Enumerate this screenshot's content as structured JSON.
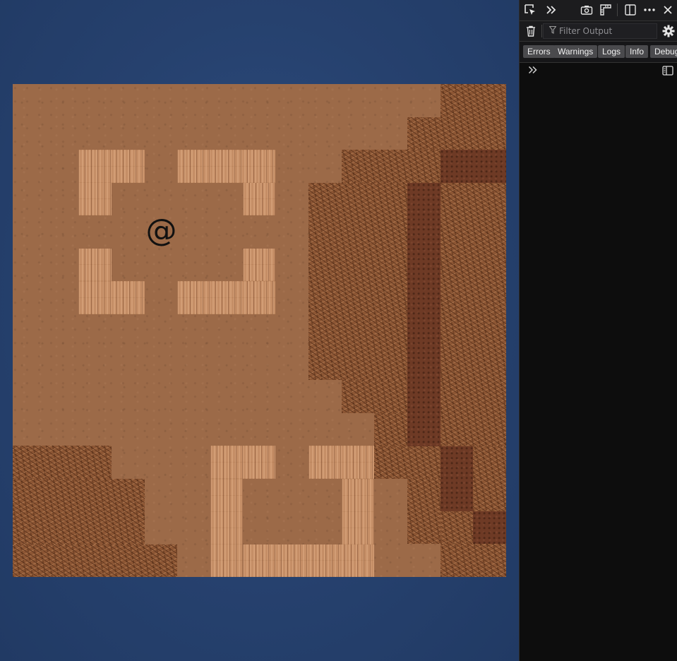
{
  "game": {
    "player_glyph": "@",
    "colors": {
      "background": "#26416e",
      "sand": "#9c6a48",
      "rock": "#8c5634",
      "wood": "#c58e66",
      "soil": "#6e3a25"
    }
  },
  "devtools": {
    "toolbar": {
      "pick_element_icon": "pick-element-icon",
      "more_tools_icon": "chevrons-right-icon",
      "screenshot_icon": "camera-icon",
      "rulers_icon": "ruler-icon",
      "responsive_icon": "responsive-design-icon",
      "menu_icon": "more-options-icon",
      "close_icon": "close-icon"
    },
    "filter": {
      "placeholder": "Filter Output",
      "value": ""
    },
    "levels": [
      "Errors",
      "Warnings",
      "Logs",
      "Info",
      "Debug"
    ],
    "console": {
      "prompt_icon": "chevrons-right-icon",
      "sidebar_icon": "sidebar-icon"
    }
  }
}
